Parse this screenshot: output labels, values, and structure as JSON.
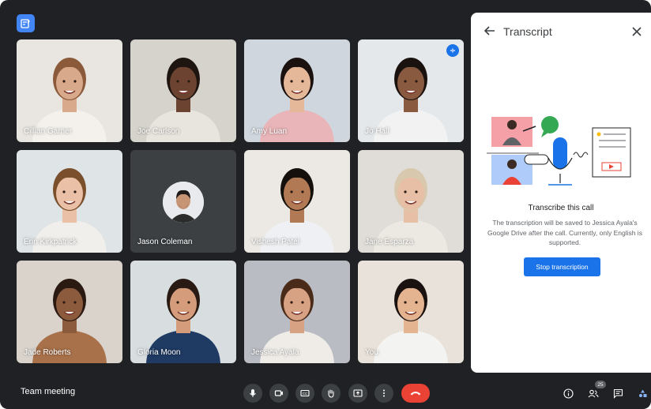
{
  "meeting": {
    "title": "Team meeting"
  },
  "participants": [
    {
      "name": "Cillian Garner",
      "bg": "#e9e6e1",
      "skin": "#d9a98c",
      "hair": "#8a5a3a",
      "shirt": "#f4f1ec"
    },
    {
      "name": "Joe Carlson",
      "bg": "#d6d2cc",
      "skin": "#6b4330",
      "hair": "#1e1410",
      "shirt": "#e8e4de"
    },
    {
      "name": "Amy Luan",
      "bg": "#cfd6de",
      "skin": "#e6b89a",
      "hair": "#1b1210",
      "shirt": "#e9b5b8"
    },
    {
      "name": "Jo Hall",
      "bg": "#e4e8ea",
      "skin": "#8a5a40",
      "hair": "#1a120f",
      "shirt": "#f2f2f2"
    },
    {
      "name": "Erin Kirkpatrick",
      "bg": "#dfe4e6",
      "skin": "#eac0a6",
      "hair": "#7a4f2c",
      "shirt": "#f0efec"
    },
    {
      "name": "Jason Coleman",
      "bg": "#3c4043",
      "skin": "#c79574",
      "hair": "#1e1a18",
      "shirt": "#2b2b2b"
    },
    {
      "name": "Vishesh Patel",
      "bg": "#ece9e4",
      "skin": "#b17a55",
      "hair": "#16100c",
      "shirt": "#eef0f3"
    },
    {
      "name": "Jane Esparza",
      "bg": "#e0ddd8",
      "skin": "#e7bfa6",
      "hair": "#d8c9ae",
      "shirt": "#ece8e2"
    },
    {
      "name": "Jade Roberts",
      "bg": "#d9d3cc",
      "skin": "#8c5a3c",
      "hair": "#2a1a12",
      "shirt": "#a8714a"
    },
    {
      "name": "Gloria Moon",
      "bg": "#d8dde0",
      "skin": "#d49c7a",
      "hair": "#2a1a14",
      "shirt": "#1f3a63"
    },
    {
      "name": "Jessica Ayala",
      "bg": "#b9bcc2",
      "skin": "#d7a184",
      "hair": "#4a2a18",
      "shirt": "#efece8"
    },
    {
      "name": "You",
      "bg": "#e8e2da",
      "skin": "#e4b491",
      "hair": "#1a1210",
      "shirt": "#f3f3f1"
    }
  ],
  "transcript": {
    "title": "Transcript",
    "heading": "Transcribe this call",
    "description": "The transcription will be saved to Jessica Ayala's Google Drive after the call. Currently, only English is supported.",
    "stop_label": "Stop transcription"
  },
  "people_count": "25",
  "colors": {
    "accent": "#1a73e8",
    "hangup": "#ea4335",
    "background": "#202124",
    "tile_dark": "#3c4043"
  },
  "icons": [
    "meet-logo-icon",
    "speaking-icon",
    "back-arrow-icon",
    "close-icon",
    "mic-icon",
    "camera-icon",
    "captions-icon",
    "raise-hand-icon",
    "present-icon",
    "more-options-icon",
    "hang-up-icon",
    "info-icon",
    "people-icon",
    "chat-icon",
    "activities-icon"
  ]
}
